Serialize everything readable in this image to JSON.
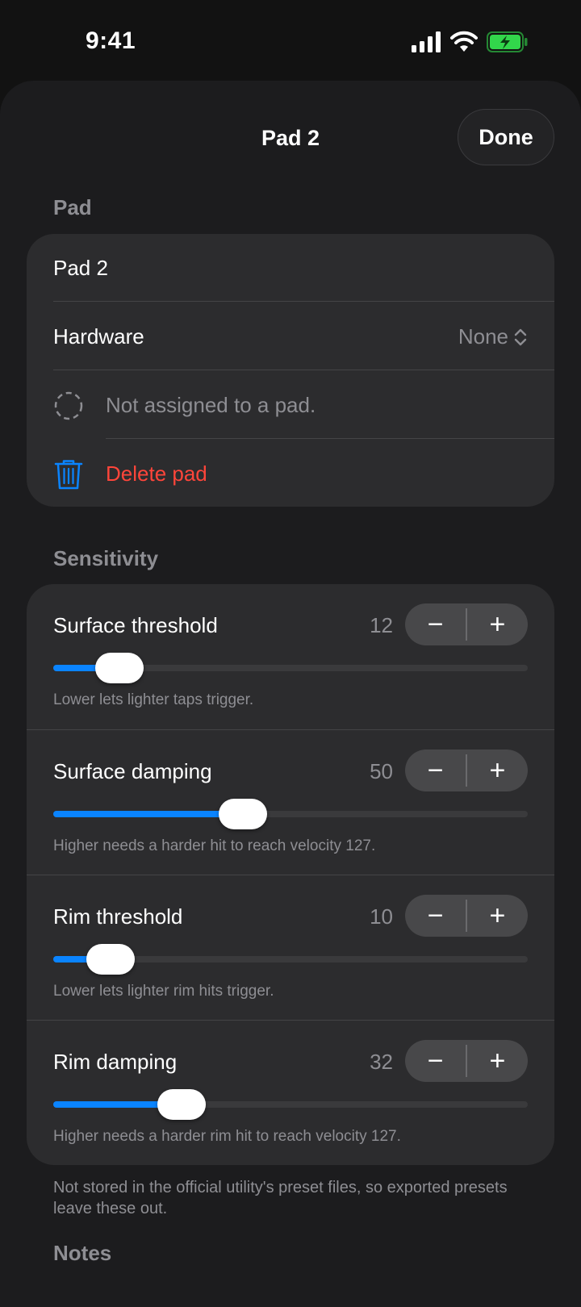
{
  "status": {
    "time": "9:41"
  },
  "nav": {
    "title": "Pad 2",
    "done_label": "Done"
  },
  "pad_section": {
    "header": "Pad",
    "name_value": "Pad 2",
    "hardware_label": "Hardware",
    "hardware_value": "None",
    "assignment_text": "Not assigned to a pad.",
    "delete_label": "Delete pad"
  },
  "sensitivity_section": {
    "header": "Sensitivity",
    "rows": [
      {
        "label": "Surface threshold",
        "value": "12",
        "fraction": 0.14,
        "caption": "Lower lets lighter taps trigger."
      },
      {
        "label": "Surface damping",
        "value": "50",
        "fraction": 0.4,
        "caption": "Higher needs a harder hit to reach velocity 127."
      },
      {
        "label": "Rim threshold",
        "value": "10",
        "fraction": 0.12,
        "caption": "Lower lets lighter rim hits trigger."
      },
      {
        "label": "Rim damping",
        "value": "32",
        "fraction": 0.27,
        "caption": "Higher needs a harder rim hit to reach velocity 127."
      }
    ],
    "stepper_minus": "−",
    "stepper_plus": "+",
    "footnote": "Not stored in the official utility's preset files, so exported presets leave these out."
  },
  "notes_section": {
    "header": "Notes"
  },
  "colors": {
    "accent": "#0a84ff",
    "danger": "#ff453a",
    "battery": "#32d74b"
  }
}
